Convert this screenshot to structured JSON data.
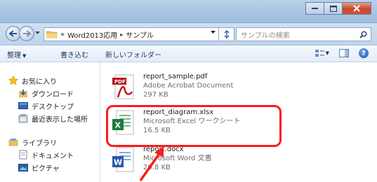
{
  "window": {
    "minimize_icon": "minimize-icon",
    "maximize_icon": "maximize-icon",
    "close_icon": "close-icon",
    "close_color": "#c8462a"
  },
  "address": {
    "overflow": "«",
    "parts": [
      "Word2013応用",
      "サンプル"
    ],
    "separator": "▸",
    "search_placeholder": "サンプルの検索"
  },
  "toolbar": {
    "organize": "整理",
    "burn": "書き込む",
    "new_folder": "新しいフォルダー"
  },
  "nav": {
    "favorites": "お気に入り",
    "downloads": "ダウンロード",
    "desktop": "デスクトップ",
    "recent": "最近表示した場所",
    "libraries": "ライブラリ",
    "documents": "ドキュメント",
    "pictures": "ピクチャ"
  },
  "files": [
    {
      "name": "report_sample.pdf",
      "type": "Adobe Acrobat Document",
      "size": "297 KB",
      "icon": "pdf-file-icon"
    },
    {
      "name": "report_diagram.xlsx",
      "type": "Microsoft Excel ワークシート",
      "size": "16.5 KB",
      "icon": "excel-file-icon"
    },
    {
      "name": "report.docx",
      "type": "Microsoft Word 文書",
      "size": "20.8 KB",
      "icon": "word-file-icon"
    }
  ],
  "annotation": {
    "highlight_color": "#ff1a1a"
  }
}
